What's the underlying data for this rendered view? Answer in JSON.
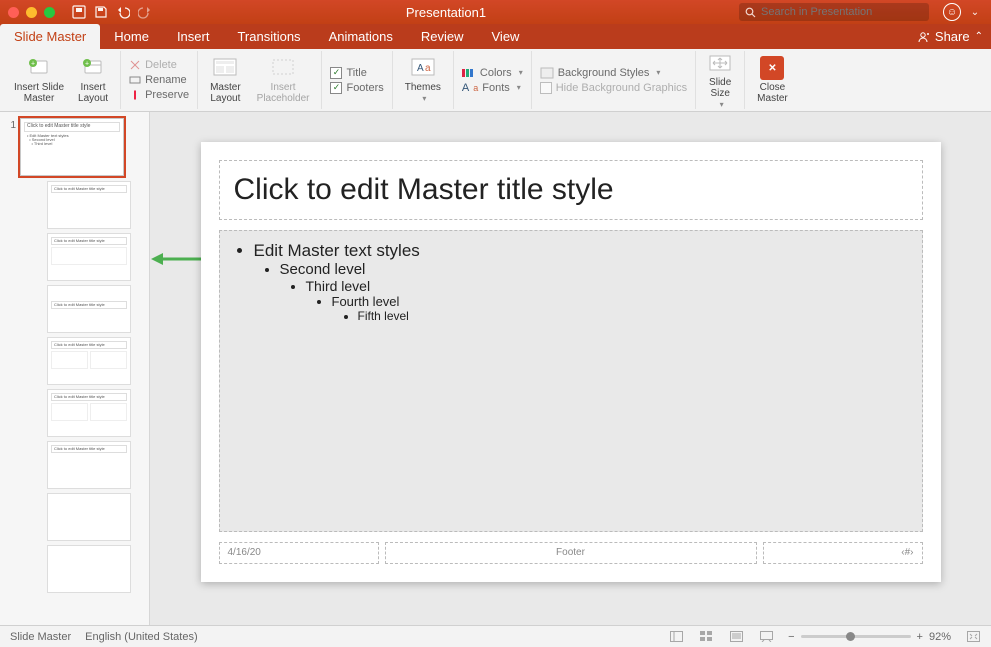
{
  "titlebar": {
    "title": "Presentation1",
    "search_placeholder": "Search in Presentation"
  },
  "tabs": {
    "items": [
      "Slide Master",
      "Home",
      "Insert",
      "Transitions",
      "Animations",
      "Review",
      "View"
    ],
    "active": 0,
    "share": "Share"
  },
  "ribbon": {
    "insert_slide_master": "Insert Slide\nMaster",
    "insert_layout": "Insert\nLayout",
    "delete": "Delete",
    "rename": "Rename",
    "preserve": "Preserve",
    "master_layout": "Master\nLayout",
    "insert_placeholder": "Insert\nPlaceholder",
    "title": "Title",
    "footers": "Footers",
    "themes": "Themes",
    "colors": "Colors",
    "fonts": "Fonts",
    "bg_styles": "Background Styles",
    "hide_bg": "Hide Background Graphics",
    "slide_size": "Slide\nSize",
    "close_master": "Close\nMaster"
  },
  "thumbs": {
    "master_number": "1",
    "master_title": "Click to edit Master title style",
    "layout_titles": [
      "Click to edit Master title style",
      "Click to edit Master title style",
      "Click to edit Master title style",
      "Click to edit Master title style",
      "Click to edit Master title style",
      "Click to edit Master title style",
      "",
      ""
    ]
  },
  "slide": {
    "title": "Click to edit Master title style",
    "levels": [
      "Edit Master text styles",
      "Second level",
      "Third level",
      "Fourth level",
      "Fifth level"
    ],
    "date": "4/16/20",
    "footer": "Footer",
    "pagenum": "‹#›"
  },
  "status": {
    "mode": "Slide Master",
    "lang": "English (United States)",
    "zoom": "92%"
  }
}
